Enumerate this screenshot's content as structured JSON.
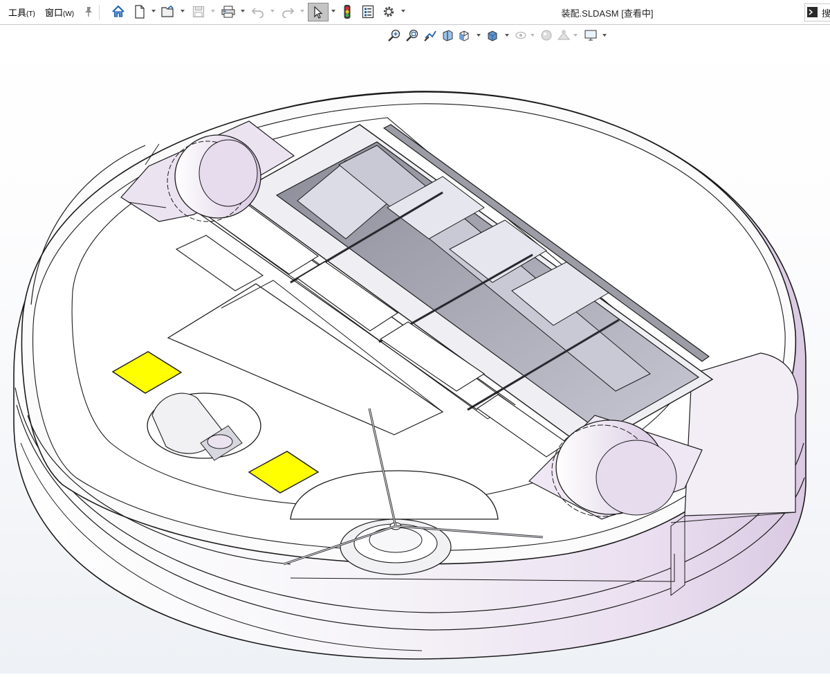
{
  "menu": {
    "tools": {
      "label": "工具",
      "accel": "(T)"
    },
    "window": {
      "label": "窗口",
      "accel": "(W)"
    }
  },
  "document": {
    "title": "装配.SLDASM [查看中]"
  },
  "command_search": {
    "label": "搜"
  },
  "toolbar": {
    "buttons": [
      "home-icon",
      "new-document-icon",
      "open-icon",
      "save-icon",
      "print-icon",
      "undo-icon",
      "redo-icon",
      "select-icon",
      "rebuild-icon",
      "file-properties-icon",
      "options-icon"
    ]
  },
  "view_toolbar": {
    "buttons": [
      "zoom-to-fit-icon",
      "zoom-to-area-icon",
      "previous-view-icon",
      "section-view-icon",
      "view-orientation-icon",
      "display-style-icon",
      "hide-show-items-icon",
      "edit-appearance-icon",
      "apply-scene-icon",
      "view-settings-icon"
    ]
  },
  "colors": {
    "accent_yellow": "#ffff00",
    "part_lavender": "#e3d8e8",
    "edge_dark": "#1a1a1a",
    "shadow_lavender": "#c9b9d3"
  }
}
